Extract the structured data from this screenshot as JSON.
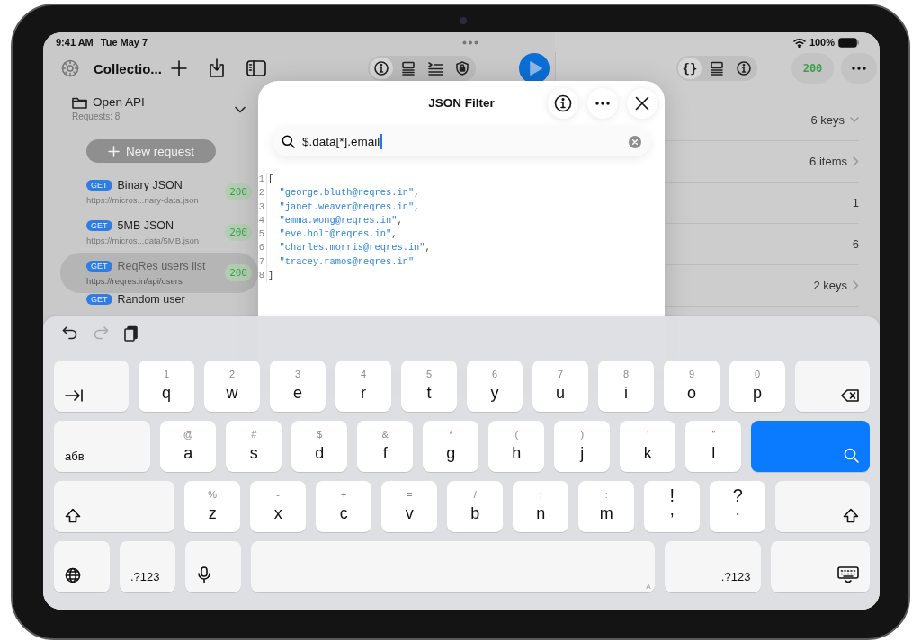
{
  "status_bar": {
    "time": "9:41 AM",
    "date": "Tue May 7",
    "battery": "100%"
  },
  "left_toolbar": {
    "title": "Collectio...",
    "segments": [
      {
        "kind": "info",
        "selected": true
      },
      {
        "kind": "layout",
        "selected": false
      },
      {
        "kind": "list",
        "selected": false
      },
      {
        "kind": "shield",
        "selected": false
      }
    ]
  },
  "sidebar": {
    "folder": {
      "name": "Open API",
      "subtitle": "Requests: 8",
      "expanded": true
    },
    "new_request_button": "New request",
    "requests": [
      {
        "method": "GET",
        "name": "Binary JSON",
        "url": "https://micros...nary-data.json",
        "status": "200",
        "selected": false
      },
      {
        "method": "GET",
        "name": "5MB JSON",
        "url": "https://micros...data/5MB.json",
        "status": "200",
        "selected": false
      },
      {
        "method": "GET",
        "name": "ReqRes users list",
        "url": "https://reqres.in/api/users",
        "status": "200",
        "selected": true
      },
      {
        "method": "GET",
        "name": "Random user",
        "selected": false
      }
    ]
  },
  "right_toolbar": {
    "segments": [
      {
        "kind": "text",
        "label": "{}",
        "selected": true
      },
      {
        "kind": "layout",
        "selected": false
      },
      {
        "kind": "info",
        "selected": false
      }
    ],
    "status": "200"
  },
  "tree_rows": [
    {
      "kind": "group",
      "value": "6 keys",
      "expanded": true
    },
    {
      "kind": "group",
      "value": "6 items",
      "expanded": false
    },
    {
      "kind": "value",
      "value": "1"
    },
    {
      "kind": "value",
      "value": "6"
    },
    {
      "kind": "group",
      "value": "2 keys",
      "expanded": false
    }
  ],
  "json_filter": {
    "title": "JSON Filter",
    "query": "$.data[*].email",
    "lines": [
      {
        "number": "1",
        "tokens": [
          {
            "kind": "punct",
            "text": "["
          }
        ]
      },
      {
        "number": "2",
        "tokens": [
          {
            "kind": "string",
            "text": "  \"george.bluth@reqres.in\""
          },
          {
            "kind": "punct",
            "text": ","
          }
        ]
      },
      {
        "number": "3",
        "tokens": [
          {
            "kind": "string",
            "text": "  \"janet.weaver@reqres.in\""
          },
          {
            "kind": "punct",
            "text": ","
          }
        ]
      },
      {
        "number": "4",
        "tokens": [
          {
            "kind": "string",
            "text": "  \"emma.wong@reqres.in\""
          },
          {
            "kind": "punct",
            "text": ","
          }
        ]
      },
      {
        "number": "5",
        "tokens": [
          {
            "kind": "string",
            "text": "  \"eve.holt@reqres.in\""
          },
          {
            "kind": "punct",
            "text": ","
          }
        ]
      },
      {
        "number": "6",
        "tokens": [
          {
            "kind": "string",
            "text": "  \"charles.morris@reqres.in\""
          },
          {
            "kind": "punct",
            "text": ","
          }
        ]
      },
      {
        "number": "7",
        "tokens": [
          {
            "kind": "string",
            "text": "  \"tracey.ramos@reqres.in\""
          }
        ]
      },
      {
        "number": "8",
        "tokens": [
          {
            "kind": "punct",
            "text": "]"
          }
        ]
      }
    ]
  },
  "keyboard": {
    "toolbar": [
      {
        "kind": "undo",
        "disabled": false
      },
      {
        "kind": "redo",
        "disabled": true
      },
      {
        "kind": "paste",
        "disabled": false
      }
    ],
    "rows": [
      [
        {
          "kind": "tab"
        },
        {
          "kind": "letter",
          "label": "q",
          "hint": "1"
        },
        {
          "kind": "letter",
          "label": "w",
          "hint": "2"
        },
        {
          "kind": "letter",
          "label": "e",
          "hint": "3"
        },
        {
          "kind": "letter",
          "label": "r",
          "hint": "4"
        },
        {
          "kind": "letter",
          "label": "t",
          "hint": "5"
        },
        {
          "kind": "letter",
          "label": "y",
          "hint": "6"
        },
        {
          "kind": "letter",
          "label": "u",
          "hint": "7"
        },
        {
          "kind": "letter",
          "label": "i",
          "hint": "8"
        },
        {
          "kind": "letter",
          "label": "o",
          "hint": "9"
        },
        {
          "kind": "letter",
          "label": "p",
          "hint": "0"
        },
        {
          "kind": "backspace"
        }
      ],
      [
        {
          "kind": "language",
          "label": "абв"
        },
        {
          "kind": "letter",
          "label": "a",
          "hint": "@"
        },
        {
          "kind": "letter",
          "label": "s",
          "hint": "#"
        },
        {
          "kind": "letter",
          "label": "d",
          "hint": "$"
        },
        {
          "kind": "letter",
          "label": "f",
          "hint": "&"
        },
        {
          "kind": "letter",
          "label": "g",
          "hint": "*"
        },
        {
          "kind": "letter",
          "label": "h",
          "hint": "("
        },
        {
          "kind": "letter",
          "label": "j",
          "hint": ")"
        },
        {
          "kind": "letter",
          "label": "k",
          "hint": "’"
        },
        {
          "kind": "letter",
          "label": "l",
          "hint": "”"
        },
        {
          "kind": "search"
        }
      ],
      [
        {
          "kind": "shift"
        },
        {
          "kind": "letter",
          "label": "z",
          "hint": "%"
        },
        {
          "kind": "letter",
          "label": "x",
          "hint": "-"
        },
        {
          "kind": "letter",
          "label": "c",
          "hint": "+"
        },
        {
          "kind": "letter",
          "label": "v",
          "hint": "="
        },
        {
          "kind": "letter",
          "label": "b",
          "hint": "/"
        },
        {
          "kind": "letter",
          "label": "n",
          "hint": ";"
        },
        {
          "kind": "letter",
          "label": "m",
          "hint": ":"
        },
        {
          "kind": "dual",
          "label": ",",
          "hint": "!"
        },
        {
          "kind": "dual",
          "label": ".",
          "hint": "?"
        },
        {
          "kind": "shift"
        }
      ],
      [
        {
          "kind": "globe"
        },
        {
          "kind": "numbers",
          "label": ".?123"
        },
        {
          "kind": "mic"
        },
        {
          "kind": "space",
          "hint": "A"
        },
        {
          "kind": "numbers",
          "label": ".?123"
        },
        {
          "kind": "hide"
        }
      ]
    ]
  }
}
